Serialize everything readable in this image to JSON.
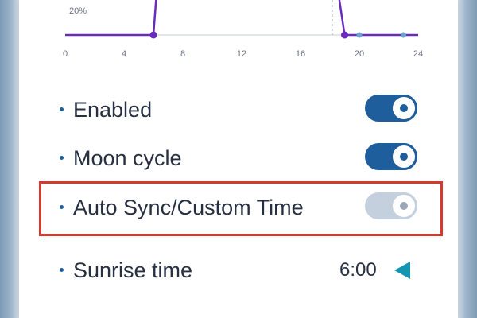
{
  "colors": {
    "accent": "#1f5e9c",
    "toggle_off": "#c4d0de",
    "chart_line": "#6a2bbf",
    "chart_marker": "#6fa3c8",
    "highlight_border": "#d63a2f",
    "arrow": "#1496b0",
    "bullet": "#1f5e9c"
  },
  "chart": {
    "y_tick_label": "20%",
    "x_ticks": [
      "0",
      "4",
      "8",
      "12",
      "16",
      "20",
      "24"
    ]
  },
  "chart_data": {
    "type": "line",
    "x": [
      0,
      6,
      6.3,
      18.4,
      19,
      20,
      23,
      24
    ],
    "values": [
      0,
      0,
      100,
      100,
      0,
      0,
      0,
      0
    ],
    "yticks": [
      "20%"
    ],
    "xticks": [
      0,
      4,
      8,
      12,
      16,
      20,
      24
    ],
    "xlim": [
      0,
      24
    ],
    "grid": false
  },
  "settings": {
    "enabled_label": "Enabled",
    "enabled_state": "on",
    "moon_cycle_label": "Moon cycle",
    "moon_cycle_state": "on",
    "auto_sync_label": "Auto Sync/Custom Time",
    "auto_sync_state": "off",
    "sunrise_label": "Sunrise time",
    "sunrise_value": "6:00",
    "arrow_icon": "triangle-left-icon"
  }
}
